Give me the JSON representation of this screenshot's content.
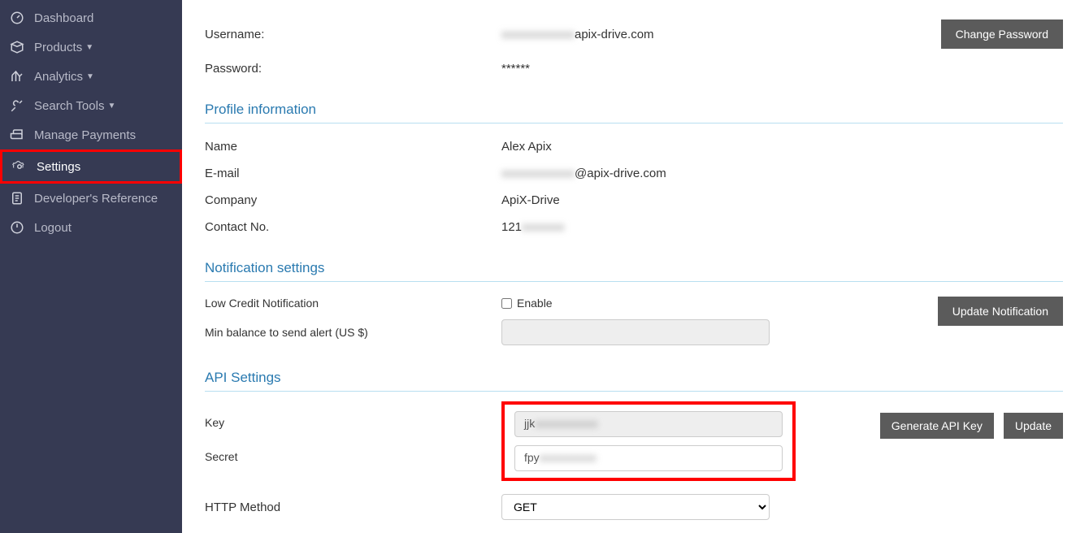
{
  "sidebar": {
    "items": [
      {
        "label": "Dashboard",
        "icon": "dashboard-icon",
        "dropdown": false
      },
      {
        "label": "Products",
        "icon": "products-icon",
        "dropdown": true
      },
      {
        "label": "Analytics",
        "icon": "analytics-icon",
        "dropdown": true
      },
      {
        "label": "Search Tools",
        "icon": "search-tools-icon",
        "dropdown": true
      },
      {
        "label": "Manage Payments",
        "icon": "payments-icon",
        "dropdown": false
      },
      {
        "label": "Settings",
        "icon": "settings-icon",
        "dropdown": false,
        "active": true
      },
      {
        "label": "Developer's Reference",
        "icon": "reference-icon",
        "dropdown": false
      },
      {
        "label": "Logout",
        "icon": "logout-icon",
        "dropdown": false
      }
    ]
  },
  "account": {
    "username_label": "Username:",
    "username_blur": "xxxxxxxxxxxx",
    "username_suffix": "apix-drive.com",
    "password_label": "Password:",
    "password_value": "******",
    "change_password_btn": "Change Password"
  },
  "profile": {
    "section_title": "Profile information",
    "name_label": "Name",
    "name_value": "Alex Apix",
    "email_label": "E-mail",
    "email_blur": "xxxxxxxxxxxx",
    "email_suffix": "@apix-drive.com",
    "company_label": "Company",
    "company_value": "ApiX-Drive",
    "contact_label": "Contact No.",
    "contact_prefix": "121",
    "contact_blur": "xxxxxxx"
  },
  "notifications": {
    "section_title": "Notification settings",
    "low_credit_label": "Low Credit Notification",
    "enable_label": "Enable",
    "enable_checked": false,
    "min_balance_label": "Min balance to send alert (US $)",
    "min_balance_value": "",
    "update_btn": "Update Notification"
  },
  "api": {
    "section_title": "API Settings",
    "key_label": "Key",
    "key_prefix": "jjk",
    "key_blur": "xxxxxxxxxxx",
    "secret_label": "Secret",
    "secret_prefix": "fpy",
    "secret_blur": "xxxxxxxxxx",
    "http_method_label": "HTTP Method",
    "http_method_value": "GET",
    "generate_btn": "Generate API Key",
    "update_btn": "Update"
  }
}
